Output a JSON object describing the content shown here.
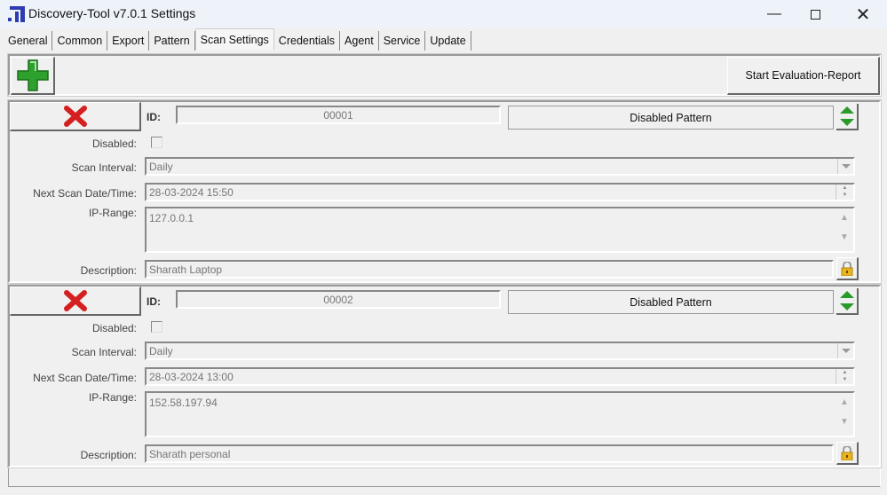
{
  "window": {
    "title": "Discovery-Tool v7.0.1 Settings"
  },
  "tabs": [
    "General",
    "Common",
    "Export",
    "Pattern",
    "Scan Settings",
    "Credentials",
    "Agent",
    "Service",
    "Update"
  ],
  "active_tab": "Scan Settings",
  "toolbar": {
    "start_report": "Start Evaluation-Report"
  },
  "labels": {
    "id": "ID:",
    "disabled": "Disabled:",
    "scan_interval": "Scan Interval:",
    "next_scan": "Next Scan Date/Time:",
    "ip_range": "IP-Range:",
    "description": "Description:"
  },
  "scans": [
    {
      "id": "00001",
      "pattern_button": "Disabled Pattern",
      "disabled": false,
      "scan_interval": "Daily",
      "next_scan": "28-03-2024 15:50",
      "ip_range": "127.0.0.1",
      "description": "Sharath Laptop"
    },
    {
      "id": "00002",
      "pattern_button": "Disabled Pattern",
      "disabled": false,
      "scan_interval": "Daily",
      "next_scan": "28-03-2024 13:00",
      "ip_range": "152.58.197.94",
      "description": "Sharath personal"
    }
  ]
}
